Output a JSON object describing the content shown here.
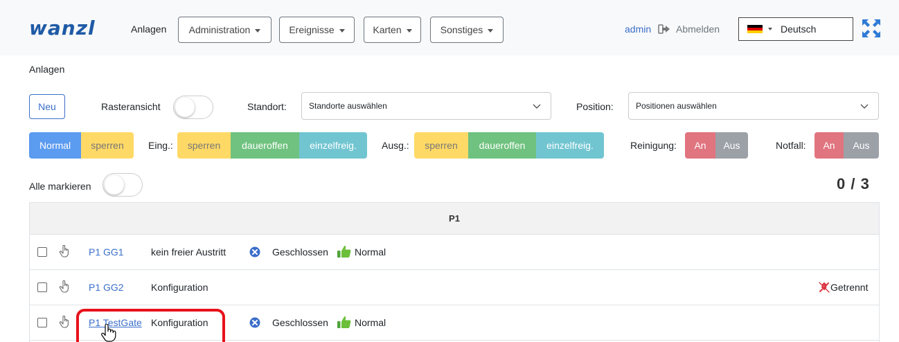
{
  "nav": {
    "logo": "wanzl",
    "active_link": "Anlagen",
    "menus": [
      {
        "label": "Administration"
      },
      {
        "label": "Ereignisse"
      },
      {
        "label": "Karten"
      },
      {
        "label": "Sonstiges"
      }
    ],
    "user": "admin",
    "logout": "Abmelden",
    "language": "Deutsch",
    "logout_icon": "sign-out-icon",
    "fullscreen_icon": "expand-arrows-icon",
    "flag_colors": [
      "#000000",
      "#dd0000",
      "#ffce00"
    ]
  },
  "page": {
    "title": "Anlagen"
  },
  "filters": {
    "new_button": "Neu",
    "grid_view_label": "Rasteransicht",
    "location_label": "Standort:",
    "location_placeholder": "Standorte auswählen",
    "position_label": "Position:",
    "position_placeholder": "Positionen auswählen"
  },
  "actions": {
    "mode": {
      "normal": "Normal",
      "lock": "sperren"
    },
    "entry": {
      "label": "Eing.:",
      "lock": "sperren",
      "open": "daueroffen",
      "single": "einzelfreig."
    },
    "exit": {
      "label": "Ausg.:",
      "lock": "sperren",
      "open": "daueroffen",
      "single": "einzelfreig."
    },
    "cleaning": {
      "label": "Reinigung:",
      "on": "An",
      "off": "Aus"
    },
    "emergency": {
      "label": "Notfall:",
      "on": "An",
      "off": "Aus"
    }
  },
  "selection": {
    "select_all_label": "Alle markieren",
    "counter": "0 / 3"
  },
  "table": {
    "group_header": "P1",
    "rows": [
      {
        "name": "P1 GG1",
        "description": "kein freier Austritt",
        "status": "Geschlossen",
        "state": "Normal",
        "connection": ""
      },
      {
        "name": "P1 GG2",
        "description": "Konfiguration",
        "status": "",
        "state": "",
        "connection": "Getrennt"
      },
      {
        "name": "P1 TestGate",
        "description": "Konfiguration",
        "status": "Geschlossen",
        "state": "Normal",
        "connection": ""
      }
    ]
  },
  "colors": {
    "brand": "#1f5aa6",
    "link": "#3b6ec9",
    "normal": "#5b9bf0",
    "lock": "#ffd966",
    "open": "#6fc27f",
    "single": "#71c5d1",
    "on": "#e0747f",
    "off": "#9ca1a8",
    "highlight": "#e8111b"
  }
}
